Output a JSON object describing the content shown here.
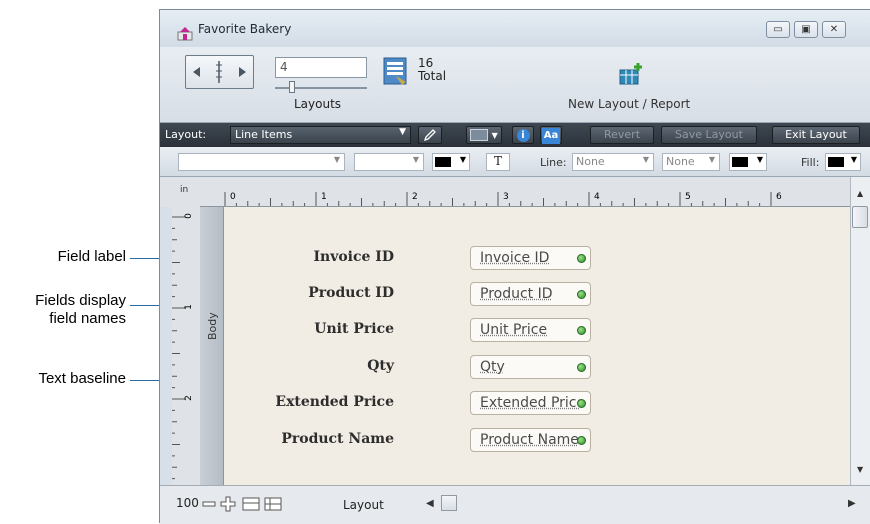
{
  "callouts": {
    "field_label": "Field label",
    "fields_display_1": "Fields display",
    "fields_display_2": "field names",
    "text_baseline": "Text baseline"
  },
  "window": {
    "title": "Favorite Bakery",
    "controls": {
      "minimize": "▭",
      "maximize": "▣",
      "close": "✕"
    }
  },
  "status_toolbar": {
    "record_number": "4",
    "layouts_label": "Layouts",
    "total_count": "16",
    "total_label": "Total",
    "new_layout_label": "New Layout / Report"
  },
  "layout_bar": {
    "layout_label": "Layout:",
    "layout_name": "Line Items",
    "info_icon": "i",
    "aa_label": "Aa",
    "revert": "Revert",
    "save_layout": "Save Layout",
    "exit_layout": "Exit Layout"
  },
  "format_bar": {
    "text_tool": "T",
    "line_label": "Line:",
    "line_value": "None",
    "line_value2": "None",
    "fill_label": "Fill:"
  },
  "ruler": {
    "unit": "in",
    "ticks": [
      "0",
      "1",
      "2",
      "3",
      "4",
      "5",
      "6"
    ],
    "vertical_ticks": [
      "0",
      "1",
      "2"
    ]
  },
  "body_part_label": "Body",
  "fields": [
    {
      "label": "Invoice ID",
      "field": "Invoice ID"
    },
    {
      "label": "Product ID",
      "field": "Product ID"
    },
    {
      "label": "Unit Price",
      "field": "Unit Price"
    },
    {
      "label": "Qty",
      "field": "Qty"
    },
    {
      "label": "Extended Price",
      "field": "Extended Price"
    },
    {
      "label": "Product Name",
      "field": "Product Name"
    }
  ],
  "bottom_bar": {
    "zoom": "100",
    "mode": "Layout"
  },
  "colors": {
    "callout_line": "#2b6aa0",
    "layout_bar": "#2f363e",
    "canvas": "#f2ede4",
    "field_indicator": "#3a9a32"
  }
}
